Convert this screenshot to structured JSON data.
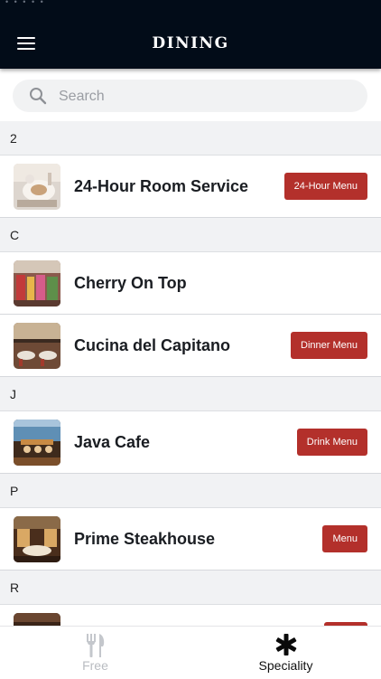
{
  "header": {
    "title": "DINING",
    "status_dots": "• • • • •"
  },
  "search": {
    "placeholder": "Search"
  },
  "sections": [
    {
      "letter": "2"
    },
    {
      "letter": "C"
    },
    {
      "letter": "J"
    },
    {
      "letter": "P"
    },
    {
      "letter": "R"
    }
  ],
  "restaurants": [
    {
      "name": "24-Hour Room Service",
      "button": "24-Hour Menu"
    },
    {
      "name": "Cherry On Top",
      "button": ""
    },
    {
      "name": "Cucina del Capitano",
      "button": "Dinner Menu"
    },
    {
      "name": "Java Cafe",
      "button": "Drink Menu"
    },
    {
      "name": "Prime Steakhouse",
      "button": "Menu"
    }
  ],
  "tabs": [
    {
      "label": "Free",
      "icon": "fork-knife-icon",
      "active": false
    },
    {
      "label": "Speciality",
      "icon": "asterisk-icon",
      "active": true
    }
  ],
  "colors": {
    "header_bg": "#020c18",
    "button_bg": "#b3302b",
    "section_bg": "#f1f2f4"
  }
}
